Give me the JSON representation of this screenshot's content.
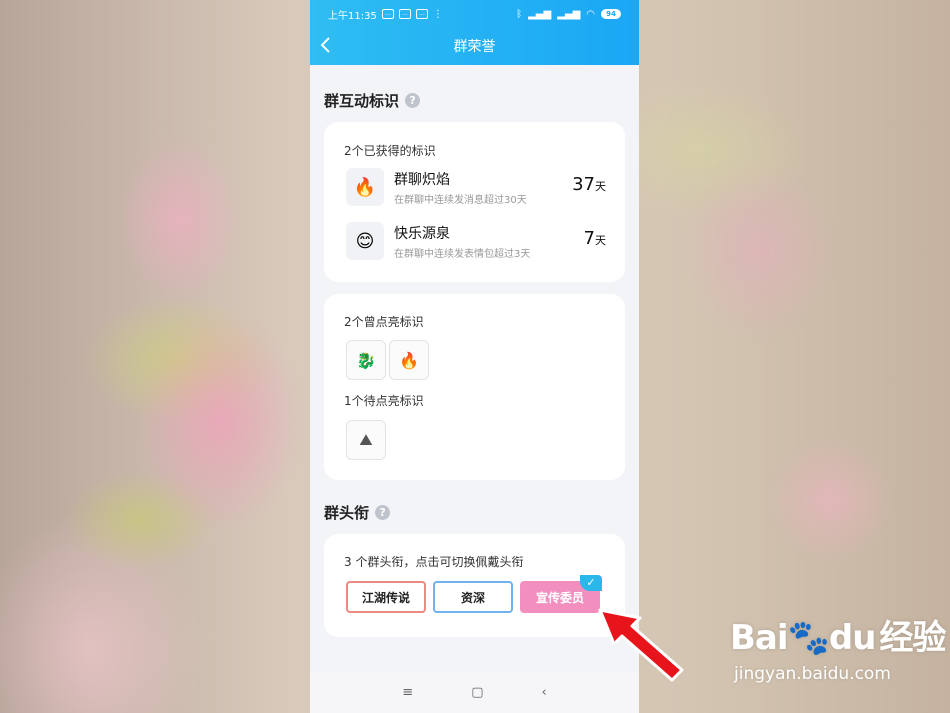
{
  "status_bar": {
    "time": "上午11:35",
    "battery": "94"
  },
  "header": {
    "title": "群荣誉"
  },
  "interaction_section": {
    "title": "群互动标识",
    "help_icon": "question-circle-icon",
    "earned": {
      "label": "2个已获得的标识",
      "items": [
        {
          "icon": "flame-icon",
          "glyph": "🔥",
          "name": "群聊炽焰",
          "desc": "在群聊中连续发消息超过30天",
          "days": "37",
          "unit": "天"
        },
        {
          "icon": "smiley-icon",
          "glyph": "😊",
          "name": "快乐源泉",
          "desc": "在群聊中连续发表情包超过3天",
          "days": "7",
          "unit": "天"
        }
      ]
    },
    "lit_label": "2个曾点亮标识",
    "lit_icons": [
      {
        "icon": "dragon-icon",
        "glyph": "🐉"
      },
      {
        "icon": "flame-grey-icon",
        "glyph": "🔥"
      }
    ],
    "pending_label": "1个待点亮标识",
    "pending_icons": [
      {
        "icon": "stone-icon",
        "glyph": "⛰"
      }
    ]
  },
  "title_section": {
    "title": "群头衔",
    "help_icon": "question-circle-icon",
    "caption": "3 个群头衔，点击可切换佩戴头衔",
    "titles": [
      {
        "label": "江湖传说",
        "border": "#e98a84",
        "text": "#222"
      },
      {
        "label": "资深",
        "border": "#6fb2ee",
        "text": "#222"
      },
      {
        "label": "宣传委员",
        "bg": "#f28fbf",
        "text": "#ffffff",
        "selected": true
      }
    ]
  },
  "nav": {
    "menu": "≡",
    "home": "▢",
    "back": "‹"
  },
  "watermark": {
    "brand": "Bai",
    "brand2": "du",
    "brand_cn": "经验",
    "url": "jingyan.baidu.com"
  },
  "colors": {
    "header": "#1aa7f4",
    "accent": "#2ab8ea",
    "arrow": "#e8141b"
  }
}
